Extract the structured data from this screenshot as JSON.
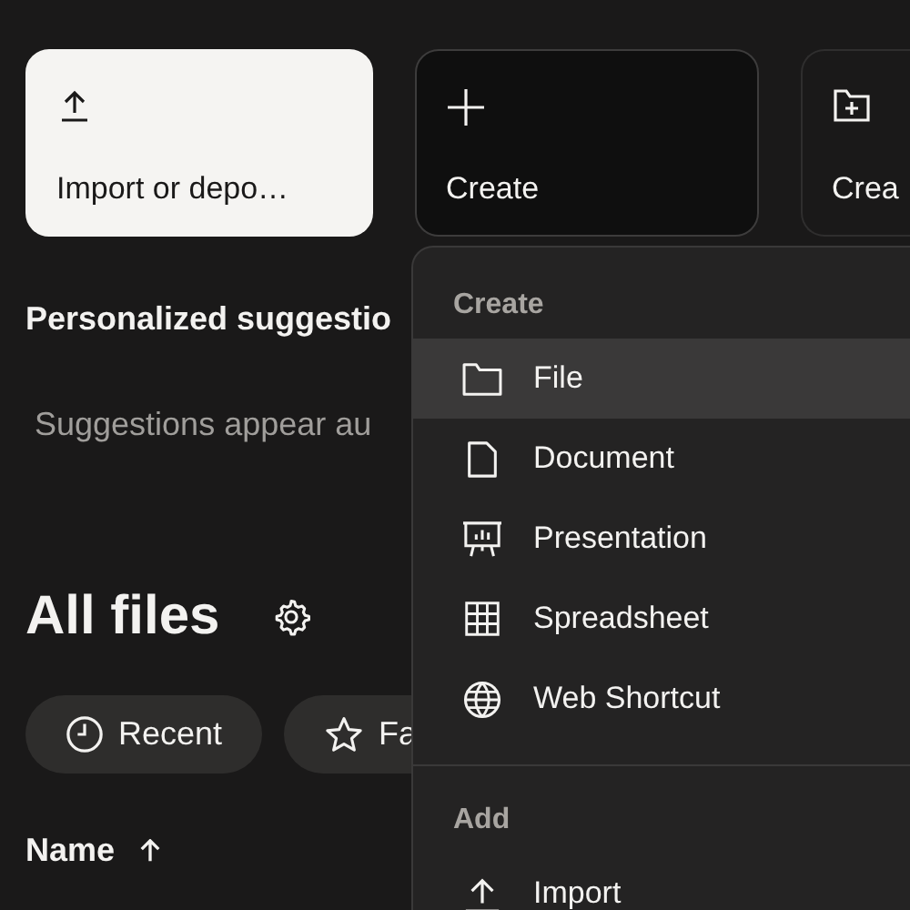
{
  "action_cards": [
    {
      "kind": "upload",
      "label": "Import or depo…",
      "selected": false
    },
    {
      "kind": "plus",
      "label": "Create",
      "selected": true
    },
    {
      "kind": "folder-plus",
      "label": "Crea",
      "selected": false
    }
  ],
  "suggestions": {
    "title": "Personalized suggestio",
    "text": "Suggestions appear au"
  },
  "files": {
    "title": "All files",
    "filters": [
      {
        "kind": "clock",
        "label": "Recent"
      },
      {
        "kind": "star",
        "label": "Fa"
      }
    ],
    "sort": {
      "label": "Name",
      "ascending": true
    }
  },
  "create_menu": {
    "sections": [
      {
        "heading": "Create",
        "items": [
          {
            "kind": "folder",
            "label": "File",
            "selected": true
          },
          {
            "kind": "document",
            "label": "Document",
            "selected": false
          },
          {
            "kind": "presentation",
            "label": "Presentation",
            "selected": false
          },
          {
            "kind": "grid",
            "label": "Spreadsheet",
            "selected": false
          },
          {
            "kind": "globe",
            "label": "Web Shortcut",
            "selected": false
          }
        ]
      },
      {
        "heading": "Add",
        "items": [
          {
            "kind": "upload",
            "label": "Import",
            "selected": false
          }
        ]
      }
    ]
  }
}
